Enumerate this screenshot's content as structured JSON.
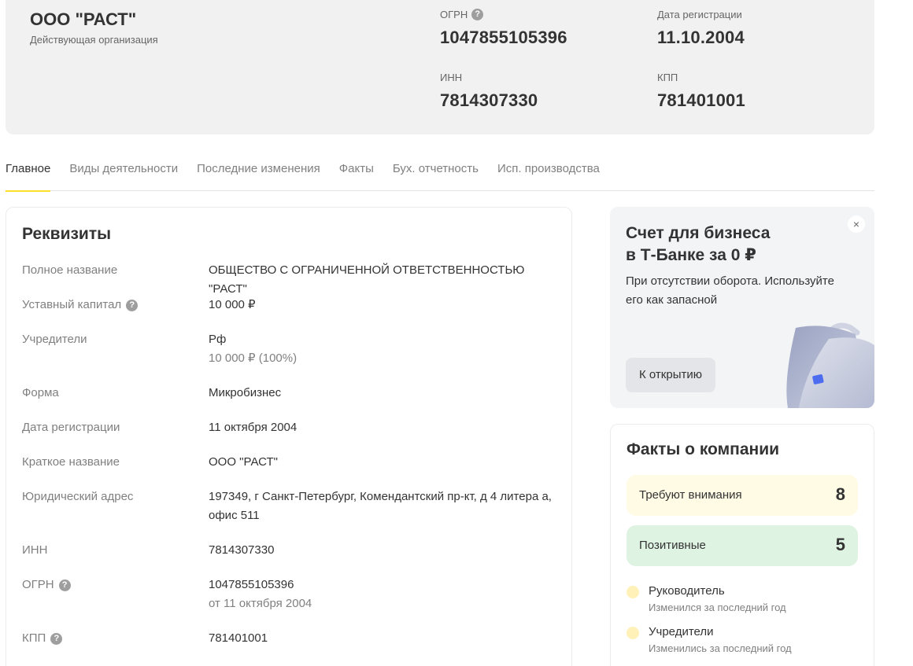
{
  "company": {
    "name": "ООО \"РАСТ\"",
    "status": "Действующая организация"
  },
  "header_fields": {
    "ogrn": {
      "label": "ОГРН",
      "value": "1047855105396"
    },
    "reg_date": {
      "label": "Дата регистрации",
      "value": "11.10.2004"
    },
    "inn": {
      "label": "ИНН",
      "value": "7814307330"
    },
    "kpp": {
      "label": "КПП",
      "value": "781401001"
    }
  },
  "tabs": [
    {
      "label": "Главное",
      "active": true
    },
    {
      "label": "Виды деятельности"
    },
    {
      "label": "Последние изменения"
    },
    {
      "label": "Факты"
    },
    {
      "label": "Бух. отчетность"
    },
    {
      "label": "Исп. производства"
    }
  ],
  "requisites": {
    "title": "Реквизиты",
    "rows": [
      {
        "key": "Полное название",
        "value": "ОБЩЕСТВО С ОГРАНИЧЕННОЙ ОТВЕТСТВЕННОСТЬЮ \"РАСТ\""
      },
      {
        "key": "Уставный капитал",
        "value": "10 000 ₽",
        "help": true
      },
      {
        "key": "Учредители",
        "value": "Рф",
        "sub": "10 000 ₽ (100%)"
      },
      {
        "key": "Форма",
        "value": "Микробизнес"
      },
      {
        "key": "Дата регистрации",
        "value": "11 октября 2004"
      },
      {
        "key": "Краткое название",
        "value": "ООО \"РАСТ\""
      },
      {
        "key": "Юридический адрес",
        "value": "197349, г Санкт-Петербург, Комендантский пр-кт, д 4 литера а, офис 511"
      },
      {
        "key": "ИНН",
        "value": "7814307330"
      },
      {
        "key": "ОГРН",
        "value": "1047855105396",
        "sub": "от 11 октября 2004",
        "help": true
      },
      {
        "key": "КПП",
        "value": "781401001",
        "help": true
      }
    ]
  },
  "promo": {
    "title": "Счет для бизнеса в Т-Банке за 0 ₽",
    "title_line1": "Счет для бизнеса",
    "title_line2": "в Т-Банке за 0 ₽",
    "text": "При отсутствии оборота. Используйте его как запасной",
    "button": "К открытию",
    "close": "×",
    "image_icon": "briefcase-icon"
  },
  "facts": {
    "title": "Факты о компании",
    "attention": {
      "label": "Требуют внимания",
      "count": "8"
    },
    "positive": {
      "label": "Позитивные",
      "count": "5"
    },
    "items": [
      {
        "title": "Руководитель",
        "subtitle": "Изменился за последний год"
      },
      {
        "title": "Учредители",
        "subtitle": "Изменились за последний год"
      }
    ]
  },
  "colors": {
    "accent_yellow": "#ffdd2d",
    "attention_bg": "#fffbe5",
    "positive_bg": "#dff3e3",
    "card_bg": "#f1f1f1"
  },
  "help_icon": "?"
}
